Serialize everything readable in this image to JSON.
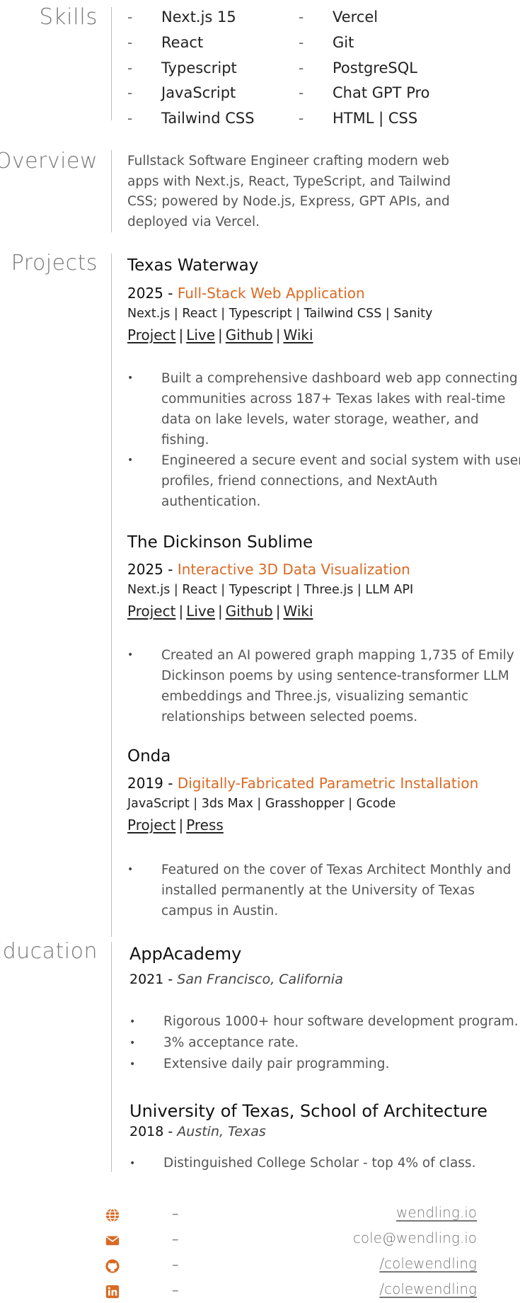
{
  "skills": {
    "title": "Skills",
    "col1": [
      "Next.js 15",
      "React",
      "Typescript",
      "JavaScript",
      "Tailwind CSS"
    ],
    "col2": [
      "Vercel",
      "Git",
      "PostgreSQL",
      "Chat GPT Pro",
      "HTML | CSS"
    ],
    "dash": "-"
  },
  "overview": {
    "title": "Overview",
    "text": "Fullstack Software Engineer crafting modern web apps with Next.js, React, TypeScript, and Tailwind CSS; powered by Node.js, Express, GPT APIs, and deployed via Vercel."
  },
  "projects": {
    "title": "Projects",
    "items": [
      {
        "name": "Texas Waterway",
        "year": "2025",
        "sep": " - ",
        "type": "Full-Stack Web Application",
        "tech": "Next.js | React | Typescript | Tailwind CSS | Sanity",
        "links": [
          "Project",
          "Live",
          "Github",
          "Wiki"
        ],
        "bullets": [
          "Built a comprehensive dashboard web app connecting communities across 187+ Texas lakes with real-time data on lake levels, water storage, weather, and fishing.",
          "Engineered a secure event and social system with user profiles, friend connections, and NextAuth authentication."
        ]
      },
      {
        "name": "The Dickinson Sublime",
        "year": "2025",
        "sep": " - ",
        "type": "Interactive 3D Data Visualization",
        "tech": "Next.js | React | Typescript | Three.js | LLM API",
        "links": [
          "Project",
          "Live",
          "Github",
          "Wiki"
        ],
        "bullets": [
          "Created an AI powered graph mapping 1,735 of Emily Dickinson poems by using sentence-transformer LLM embeddings and Three.js, visualizing semantic relationships between selected poems."
        ]
      },
      {
        "name": "Onda",
        "year": "2019",
        "sep": " - ",
        "type": "Digitally-Fabricated Parametric Installation",
        "tech": "JavaScript | 3ds Max | Grasshopper | Gcode",
        "links": [
          "Project",
          "Press"
        ],
        "bullets": [
          "Featured on the cover of Texas Architect Monthly and installed permanently at the University of Texas campus in Austin."
        ]
      }
    ]
  },
  "education": {
    "title": "Education",
    "items": [
      {
        "name": "AppAcademy",
        "year": "2021",
        "sep": " - ",
        "place": "San Francisco, California",
        "bullets": [
          "Rigorous 1000+ hour software development program.",
          "3% acceptance rate.",
          "Extensive daily pair programming."
        ]
      },
      {
        "name": "University of Texas, School of Architecture",
        "year": "2018",
        "sep": " - ",
        "place": "Austin, Texas",
        "bullets": [
          "Distinguished College Scholar - top 4% of class."
        ]
      }
    ]
  },
  "contact": {
    "dash": "–",
    "items": [
      {
        "icon": "globe-icon",
        "value": "wendling.io"
      },
      {
        "icon": "envelope-icon",
        "value": "cole@wendling.io"
      },
      {
        "icon": "github-icon",
        "value": "/colewendling"
      },
      {
        "icon": "linkedin-icon",
        "value": "/colewendling"
      }
    ]
  },
  "colors": {
    "accent": "#d96a24",
    "icon": "#d96a24",
    "rule": "#bdbdbd"
  }
}
